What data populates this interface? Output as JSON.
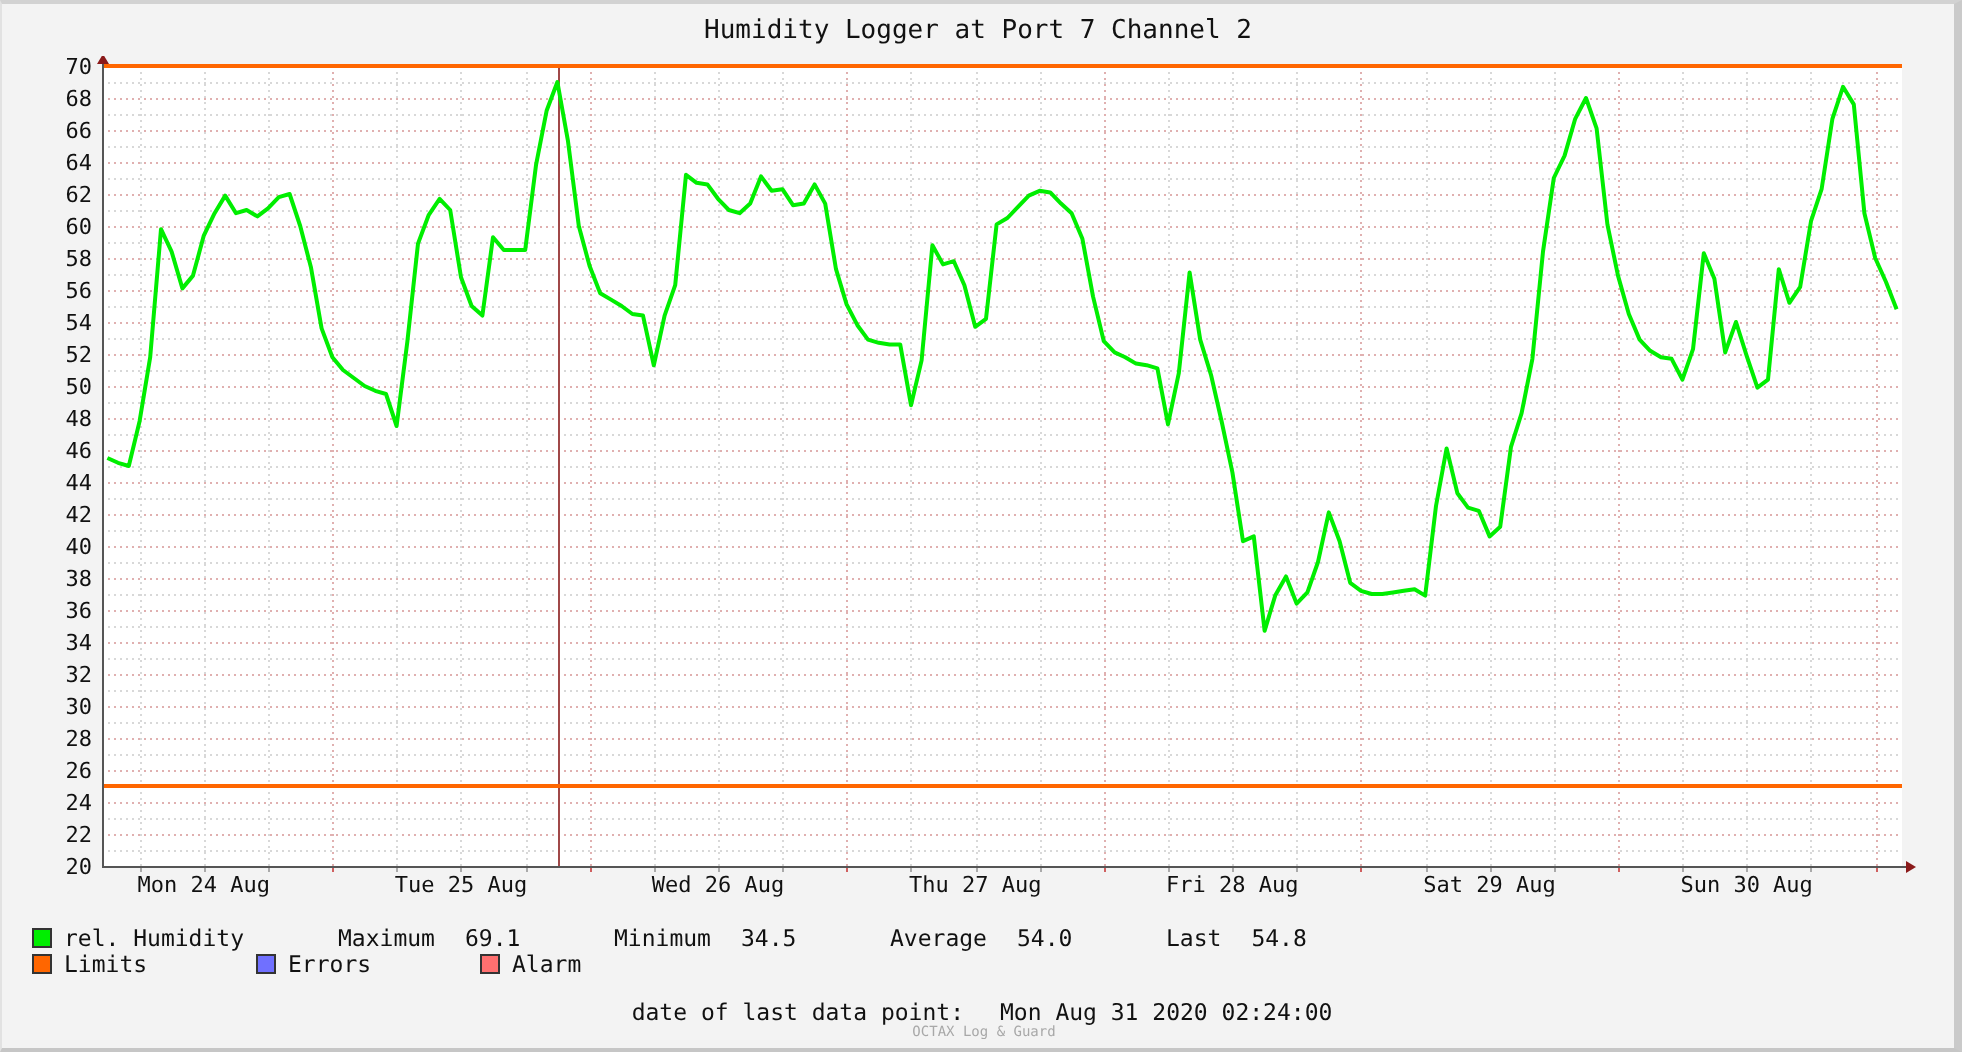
{
  "graph": {
    "chart_data": {
      "type": "line",
      "title": "Humidity Logger at Port 7 Channel 2",
      "categories": [
        null,
        null,
        null,
        null,
        null,
        null,
        null,
        null,
        null,
        "Mon 24 Aug",
        null,
        null,
        null,
        null,
        null,
        null,
        null,
        null,
        null,
        null,
        null,
        null,
        null,
        null,
        null,
        null,
        null,
        null,
        null,
        null,
        null,
        null,
        null,
        "Tue 25 Aug",
        null,
        null,
        null,
        null,
        null,
        null,
        null,
        null,
        null,
        null,
        null,
        null,
        null,
        null,
        null,
        null,
        null,
        null,
        null,
        null,
        null,
        null,
        null,
        "Wed 26 Aug",
        null,
        null,
        null,
        null,
        null,
        null,
        null,
        null,
        null,
        null,
        null,
        null,
        null,
        null,
        null,
        null,
        null,
        null,
        null,
        null,
        null,
        null,
        null,
        "Thu 27 Aug",
        null,
        null,
        null,
        null,
        null,
        null,
        null,
        null,
        null,
        null,
        null,
        null,
        null,
        null,
        null,
        null,
        null,
        null,
        null,
        null,
        null,
        null,
        null,
        "Fri 28 Aug",
        null,
        null,
        null,
        null,
        null,
        null,
        null,
        null,
        null,
        null,
        null,
        null,
        null,
        null,
        null,
        null,
        null,
        null,
        null,
        null,
        null,
        null,
        null,
        "Sat 29 Aug",
        null,
        null,
        null,
        null,
        null,
        null,
        null,
        null,
        null,
        null,
        null,
        null,
        null,
        null,
        null,
        null,
        null,
        null,
        null,
        null,
        null,
        null,
        null,
        "Sun 30 Aug",
        null,
        null,
        null,
        null,
        null,
        null,
        null,
        null,
        null,
        null,
        null,
        null,
        null,
        null
      ],
      "series": [
        {
          "name": "rel. Humidity",
          "color": "#00ee00",
          "values": [
            45.5,
            45.2,
            45.0,
            47.8,
            51.8,
            59.8,
            58.4,
            56.1,
            56.9,
            59.4,
            60.8,
            61.9,
            60.8,
            61.0,
            60.6,
            61.1,
            61.8,
            62.0,
            60.0,
            57.4,
            53.6,
            51.8,
            51.0,
            50.5,
            50.0,
            49.7,
            49.5,
            47.5,
            52.8,
            58.9,
            60.7,
            61.7,
            61.0,
            56.8,
            55.0,
            54.4,
            59.3,
            58.5,
            58.5,
            58.5,
            63.8,
            67.2,
            69.0,
            65.3,
            60.0,
            57.5,
            55.8,
            55.4,
            55.0,
            54.5,
            54.4,
            51.3,
            54.4,
            56.3,
            63.2,
            62.7,
            62.6,
            61.7,
            61.0,
            60.8,
            61.4,
            63.1,
            62.2,
            62.3,
            61.3,
            61.4,
            62.6,
            61.4,
            57.3,
            55.1,
            53.8,
            52.9,
            52.7,
            52.6,
            52.6,
            48.8,
            51.6,
            58.8,
            57.6,
            57.8,
            56.3,
            53.7,
            54.2,
            60.1,
            60.5,
            61.2,
            61.9,
            62.2,
            62.1,
            61.4,
            60.8,
            59.2,
            55.6,
            52.8,
            52.1,
            51.8,
            51.4,
            51.3,
            51.1,
            47.6,
            50.8,
            57.1,
            52.9,
            50.7,
            47.8,
            44.6,
            40.3,
            40.6,
            34.7,
            36.9,
            38.1,
            36.4,
            37.1,
            39.0,
            42.1,
            40.3,
            37.7,
            37.2,
            37.0,
            37.0,
            37.1,
            37.2,
            37.3,
            36.9,
            42.5,
            46.1,
            43.3,
            42.4,
            42.2,
            40.6,
            41.2,
            46.2,
            48.3,
            51.7,
            58.4,
            63.0,
            64.4,
            66.7,
            68.0,
            66.1,
            60.1,
            56.9,
            54.5,
            52.9,
            52.2,
            51.8,
            51.7,
            50.4,
            52.3,
            58.3,
            56.7,
            52.1,
            54.0,
            51.9,
            49.9,
            50.4,
            57.3,
            55.2,
            56.2,
            60.3,
            62.3,
            66.7,
            68.7,
            67.6,
            60.8,
            58.0,
            56.5,
            54.8
          ]
        }
      ],
      "ylim": [
        20,
        70
      ],
      "yticks": [
        20,
        22,
        24,
        26,
        28,
        30,
        32,
        34,
        36,
        38,
        40,
        42,
        44,
        46,
        48,
        50,
        52,
        54,
        56,
        58,
        60,
        62,
        64,
        66,
        68,
        70
      ],
      "grid": true,
      "ref_lines": [
        {
          "axis": "y",
          "value": 70,
          "color": "#ff6600"
        },
        {
          "axis": "y",
          "value": 25,
          "color": "#ff6600"
        }
      ]
    },
    "series_stats": [
      {
        "label": "Maximum",
        "value": "69.1"
      },
      {
        "label": "Minimum",
        "value": "34.5"
      },
      {
        "label": "Average",
        "value": "54.0"
      },
      {
        "label": "Last",
        "value": "54.8"
      }
    ],
    "legend": [
      {
        "label": "Limits",
        "color": "#ff6600"
      },
      {
        "label": "Errors",
        "color": "#7070ff"
      },
      {
        "label": "Alarm",
        "color": "#ff7070"
      }
    ],
    "last_data_point": {
      "label": "date of last data point:",
      "value": "Mon Aug 31 2020 02:24:00"
    },
    "watermark": "OCTAX Log & Guard"
  }
}
